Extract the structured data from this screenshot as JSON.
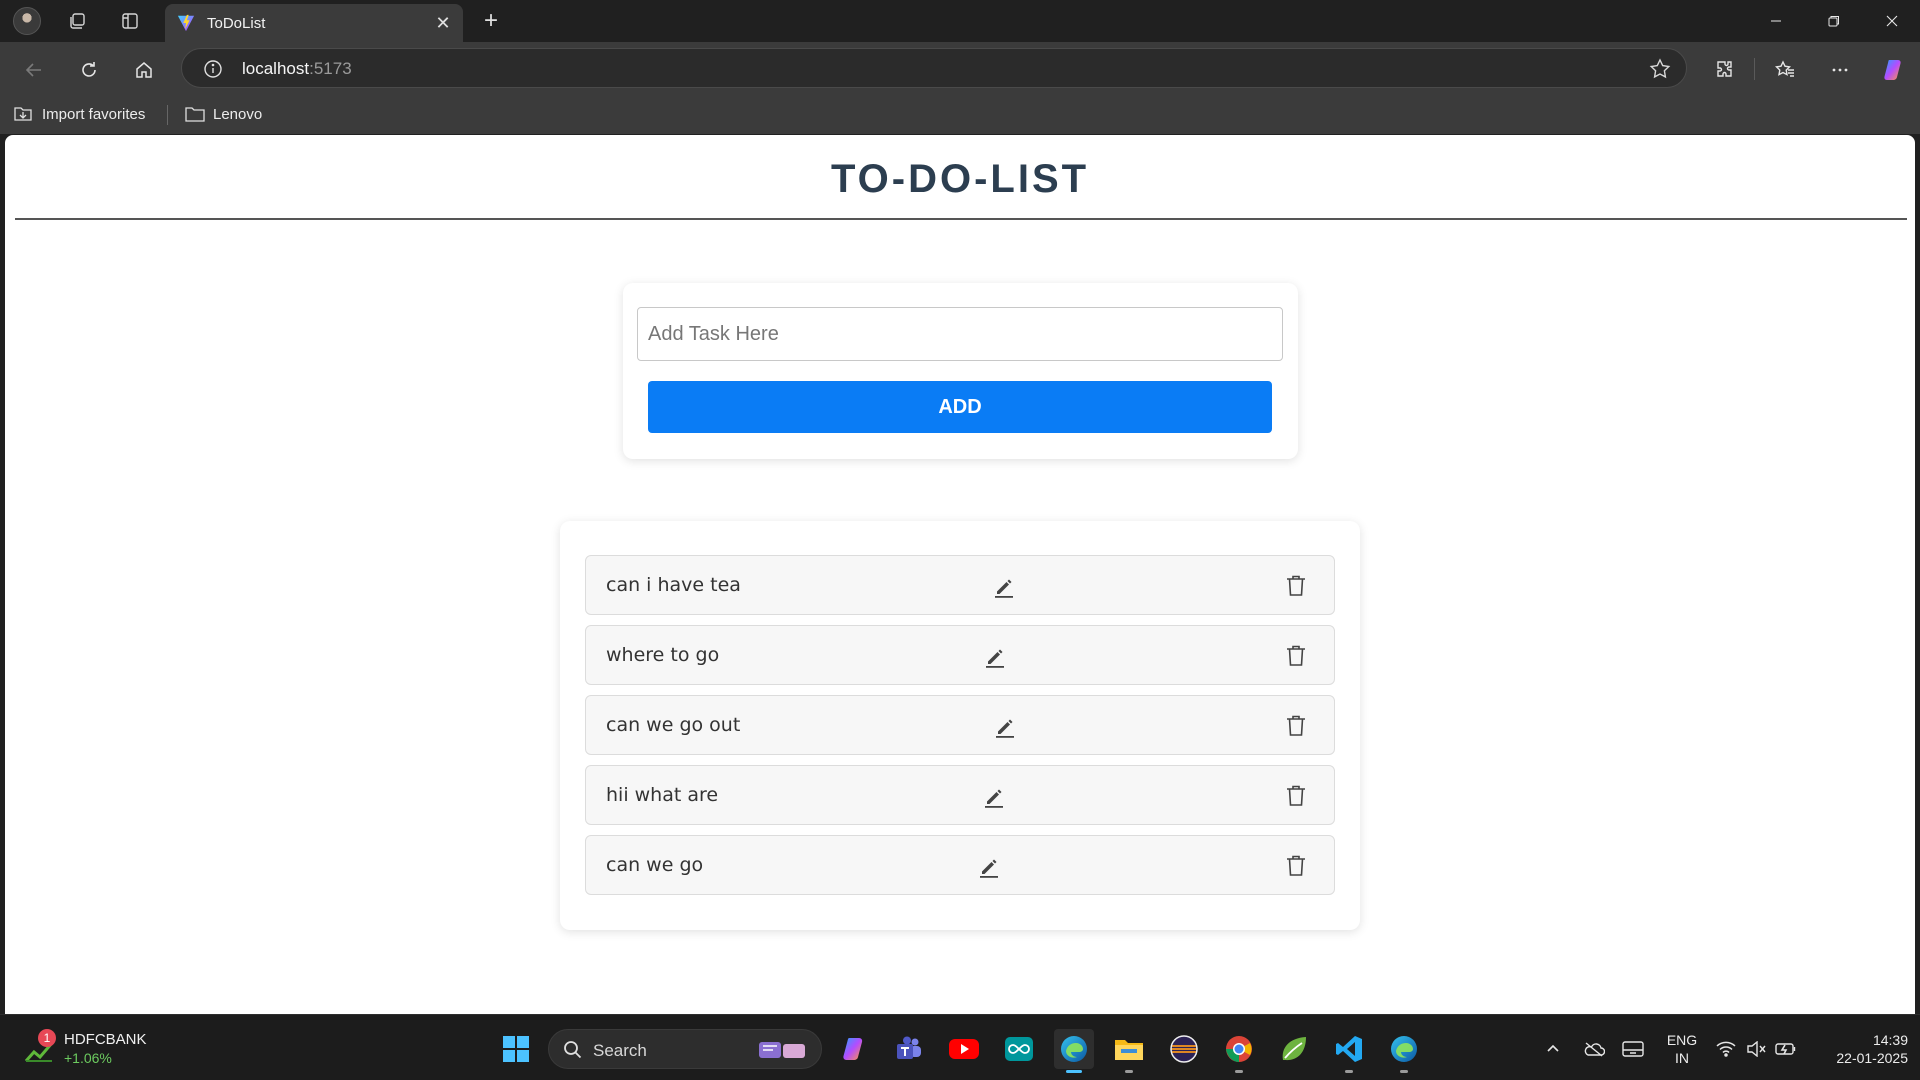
{
  "browser": {
    "tab_title": "ToDoList",
    "url_host": "localhost",
    "url_port": ":5173",
    "favorites": [
      "Import favorites",
      "Lenovo"
    ]
  },
  "app": {
    "title": "TO-DO-LIST",
    "input_placeholder": "Add Task Here",
    "input_value": "",
    "add_label": "ADD",
    "tasks": [
      {
        "text": "can i have tea"
      },
      {
        "text": "where to go"
      },
      {
        "text": "can we go out"
      },
      {
        "text": "hii what are"
      },
      {
        "text": "can we go"
      }
    ],
    "colors": {
      "title": "#2c3e50",
      "button": "#0a7cf5"
    }
  },
  "taskbar": {
    "stock_badge": "1",
    "stock_name": "HDFCBANK",
    "stock_change": "+1.06%",
    "search_label": "Search",
    "lang_line1": "ENG",
    "lang_line2": "IN",
    "time": "14:39",
    "date": "22-01-2025"
  }
}
